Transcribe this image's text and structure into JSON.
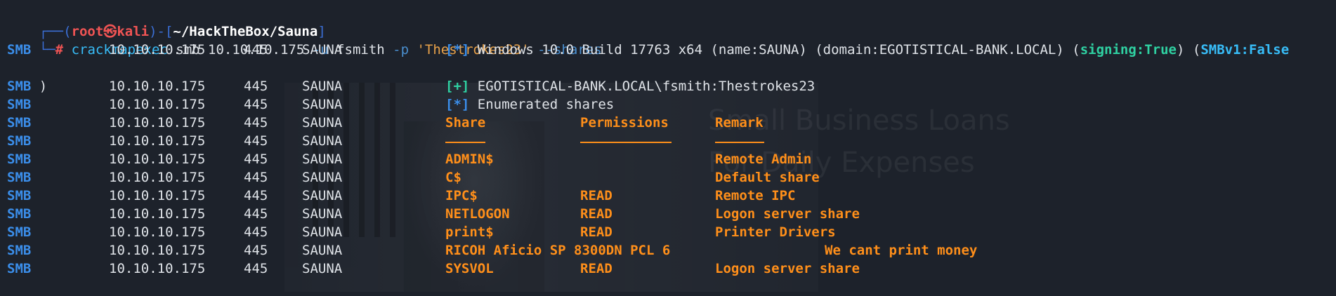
{
  "prompt": {
    "corner1": "┌──(",
    "user": "root",
    "skull": "㉿",
    "host": "kali",
    "sep": ")-[",
    "path": "~/HackTheBox/Sauna",
    "close": "]",
    "corner2": "└─",
    "hash": "#",
    "cmd": "crackmapexec",
    "arg1": " smb 10.10.10.175 ",
    "flag_u": "-u",
    "user_arg": " fsmith ",
    "flag_p": "-p",
    "pass_arg": " 'Thestrokes23'",
    "flag_shares": " --shares"
  },
  "background": {
    "ad_line1": "Small Business Loans",
    "ad_line2": "For Daily Expenses"
  },
  "info_line": {
    "tag": "[*]",
    "text1": " Windows 10.0 Build 17763 x64 (name:SAUNA) (domain:EGOTISTICAL-BANK.LOCAL) (",
    "signing": "signing:True",
    "text2": ") (",
    "smbv1": "SMBv1:False",
    "wrap": ")"
  },
  "rows_common": {
    "proto": "SMB",
    "ip": "10.10.10.175",
    "port": "445",
    "host": "SAUNA"
  },
  "auth_line": {
    "tag": "[+]",
    "text": " EGOTISTICAL-BANK.LOCAL\\fsmith:Thestrokes23"
  },
  "enum_line": {
    "tag": "[*]",
    "text": " Enumerated shares"
  },
  "headers": {
    "share": "Share",
    "perm": "Permissions",
    "remark": "Remark"
  },
  "shares": [
    {
      "share": "ADMIN$",
      "perm": "",
      "remark": "Remote Admin"
    },
    {
      "share": "C$",
      "perm": "",
      "remark": "Default share"
    },
    {
      "share": "IPC$",
      "perm": "READ",
      "remark": "Remote IPC"
    },
    {
      "share": "NETLOGON",
      "perm": "READ",
      "remark": "Logon server share"
    },
    {
      "share": "print$",
      "perm": "READ",
      "remark": "Printer Drivers"
    },
    {
      "share": "RICOH Aficio SP 8300DN PCL 6",
      "perm": "",
      "remark": "We cant print money"
    },
    {
      "share": "SYSVOL",
      "perm": "READ",
      "remark": "Logon server share"
    }
  ],
  "colors": {
    "background": "#1d222b",
    "smb": "#3b8eea",
    "share_text": "#ff8f1a",
    "signing": "#2fd1a2",
    "prompt_red": "#f05454"
  }
}
